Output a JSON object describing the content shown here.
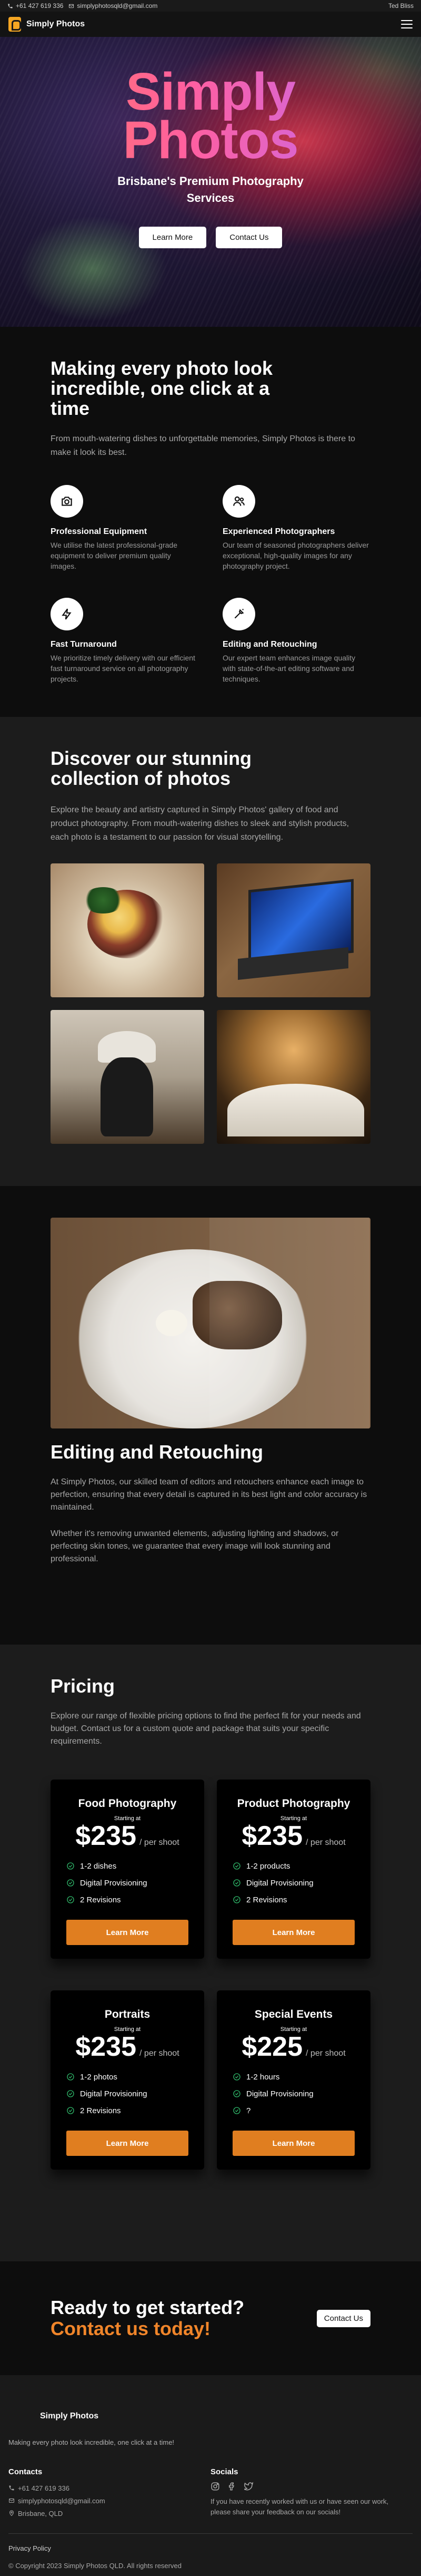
{
  "topbar": {
    "phone": "+61 427 619 336",
    "email": "simplyphotosqld@gmail.com",
    "credit": "Ted Bliss"
  },
  "nav": {
    "brand": "Simply Photos",
    "menu_icon": "hamburger-icon"
  },
  "hero": {
    "title_line1": "Simply",
    "title_line2": "Photos",
    "subtitle": "Brisbane's Premium Photography Services",
    "learn_more": "Learn More",
    "contact_us": "Contact Us"
  },
  "features": {
    "heading": "Making every photo look incredible, one click at a time",
    "lead": "From mouth-watering dishes to unforgettable memories, Simply Photos is there to make it look its best.",
    "items": [
      {
        "icon": "camera-icon",
        "title": "Professional Equipment",
        "text": "We utilise the latest professional-grade equipment to deliver premium quality images."
      },
      {
        "icon": "users-icon",
        "title": "Experienced Photographers",
        "text": "Our team of seasoned photographers deliver exceptional, high-quality images for any photography project."
      },
      {
        "icon": "lightning-icon",
        "title": "Fast Turnaround",
        "text": "We prioritize timely delivery with our efficient fast turnaround service on all photography projects."
      },
      {
        "icon": "wand-icon",
        "title": "Editing and Retouching",
        "text": "Our expert team enhances image quality with state-of-the-art editing software and techniques."
      }
    ]
  },
  "gallery": {
    "heading": "Discover our stunning collection of photos",
    "lead": "Explore the beauty and artistry captured in Simply Photos' gallery of food and product photography. From mouth-watering dishes to sleek and stylish products, each photo is a testament to our passion for visual storytelling."
  },
  "editing": {
    "heading": "Editing and Retouching",
    "para1": "At Simply Photos, our skilled team of editors and retouchers enhance each image to perfection, ensuring that every detail is captured in its best light and color accuracy is maintained.",
    "para2": "Whether it's removing unwanted elements, adjusting lighting and shadows, or perfecting skin tones, we guarantee that every image will look stunning and professional."
  },
  "pricing": {
    "heading": "Pricing",
    "lead": "Explore our range of flexible pricing options to find the perfect fit for your needs and budget. Contact us for a custom quote and package that suits your specific requirements.",
    "starting_at": "Starting at",
    "per_shoot": "/ per shoot",
    "button": "Learn More",
    "plans": [
      {
        "title": "Food Photography",
        "price": "$235",
        "features": [
          "1-2 dishes",
          "Digital Provisioning",
          "2 Revisions"
        ]
      },
      {
        "title": "Product Photography",
        "price": "$235",
        "features": [
          "1-2 products",
          "Digital Provisioning",
          "2 Revisions"
        ]
      },
      {
        "title": "Portraits",
        "price": "$235",
        "features": [
          "1-2 photos",
          "Digital Provisioning",
          "2 Revisions"
        ]
      },
      {
        "title": "Special Events",
        "price": "$225",
        "features": [
          "1-2 hours",
          "Digital Provisioning",
          "?"
        ]
      }
    ]
  },
  "cta": {
    "line1": "Ready to get started?",
    "line2": "Contact us today!",
    "button": "Contact Us"
  },
  "footer": {
    "brand": "Simply Photos",
    "tagline": "Making every photo look incredible, one click at a time!",
    "contacts_heading": "Contacts",
    "phone": "+61 427 619 336",
    "email": "simplyphotosqld@gmail.com",
    "location": "Brisbane, QLD",
    "socials_heading": "Socials",
    "feedback": "If you have recently worked with us or have seen our work, please share your feedback on our socials!",
    "privacy": "Privacy Policy",
    "copyright": "© Copyright 2023 Simply Photos QLD. All rights reserved"
  },
  "colors": {
    "accent_orange": "#e07e20",
    "cta_orange": "#f0852a",
    "logo_yellow": "#f5a623"
  }
}
